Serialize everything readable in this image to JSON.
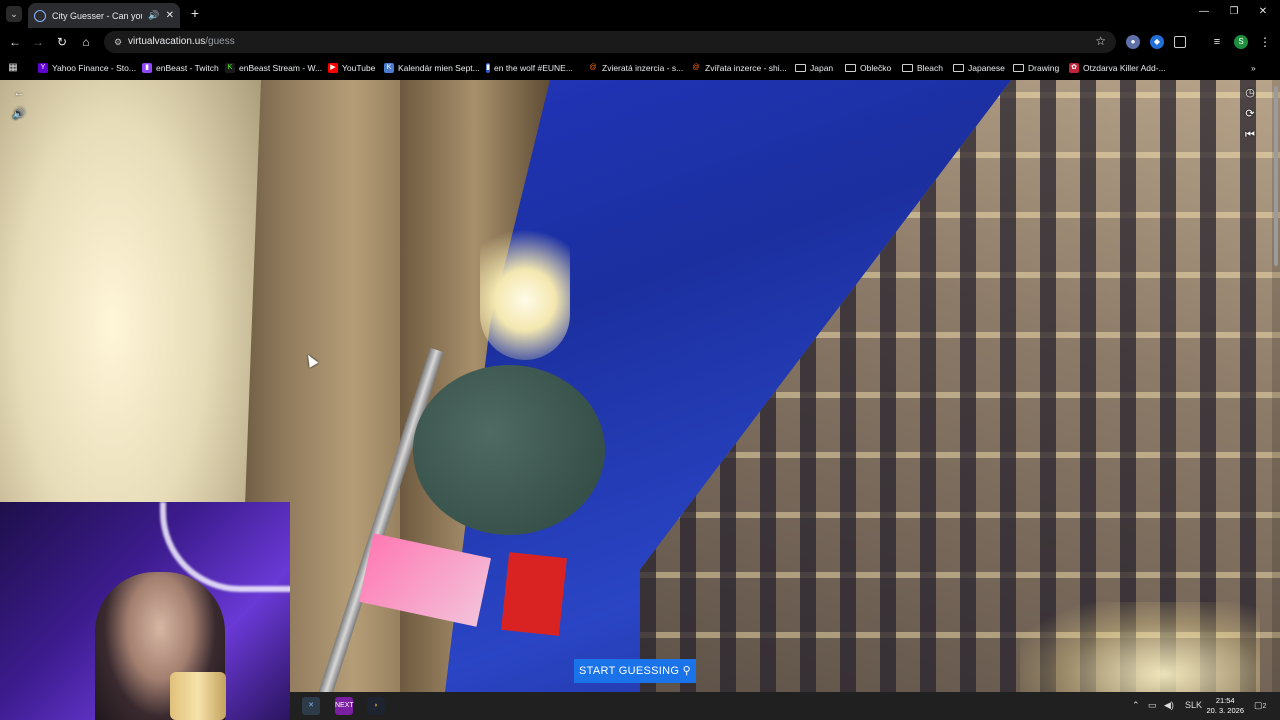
{
  "browser": {
    "tab": {
      "title": "City Guesser - Can you gue",
      "audio_icon": "🔊",
      "close": "✕"
    },
    "new_tab": "+",
    "window_controls": {
      "minimize": "—",
      "restore": "❐",
      "close": "✕"
    },
    "toolbar": {
      "back": "←",
      "forward": "→",
      "reload": "↻",
      "home": "⌂"
    },
    "url": {
      "host": "virtualvacation.us",
      "path": "/guess"
    },
    "bookmarks": [
      {
        "label": "Yahoo Finance - Sto...",
        "color": "#6001d2",
        "glyph": "Y"
      },
      {
        "label": "enBeast - Twitch",
        "color": "#9146ff",
        "glyph": "▮"
      },
      {
        "label": "enBeast Stream - W...",
        "color": "#53fc18",
        "glyph": "K"
      },
      {
        "label": "YouTube",
        "color": "#ff0000",
        "glyph": "▶"
      },
      {
        "label": "Kalendár mien Sept...",
        "color": "#4a7bd0",
        "glyph": "K"
      },
      {
        "label": "en the wolf #EUNE...",
        "color": "#2f5bd3",
        "glyph": "▮"
      },
      {
        "label": "Zvieratá inzercia - s...",
        "color": "#ff6a00",
        "glyph": "@"
      },
      {
        "label": "Zvířata inzerce - shi...",
        "color": "#ff6a00",
        "glyph": "@"
      },
      {
        "label": "Japan",
        "folder": true
      },
      {
        "label": "Oblečko",
        "folder": true
      },
      {
        "label": "Bleach",
        "folder": true
      },
      {
        "label": "Japanese",
        "folder": true
      },
      {
        "label": "Drawing",
        "folder": true
      },
      {
        "label": "Otzdarva Killer Add-...",
        "color": "#c0233b",
        "glyph": "✿"
      }
    ],
    "overflow": "»"
  },
  "street_view": {
    "back_icon": "←",
    "sound_icon": "🔊",
    "time_icon": "◷",
    "refresh_icon": "⟳",
    "restart_icon": "⏮",
    "start_button": "START GUESSING ⚲"
  },
  "taskbar": {
    "language": "SLK",
    "time": "21:54",
    "date": "20. 3. 2026",
    "notification_count": "2",
    "app_next_label": "NEXT"
  }
}
